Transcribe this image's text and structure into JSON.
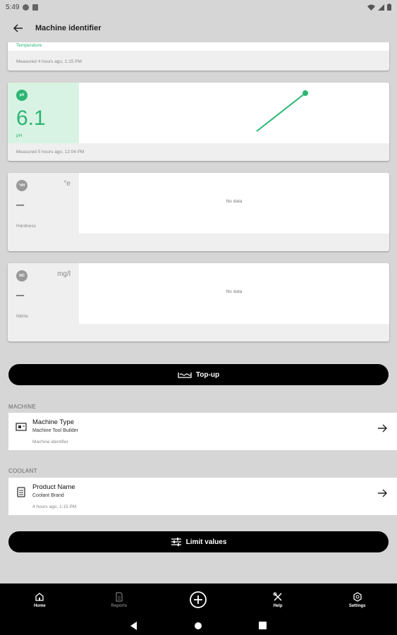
{
  "status_bar": {
    "time": "5:49"
  },
  "app_bar": {
    "title": "Machine identifier"
  },
  "cards": [
    {
      "label": "Temperature",
      "measured": "Measured 4 hours ago, 1:15 PM"
    },
    {
      "badge": "pH",
      "value": "6.1",
      "label": "pH",
      "measured": "Measured 5 hours ago, 12:04 PM",
      "accent": "#2bb673",
      "accent_bg": "#d8f3e3"
    },
    {
      "badge": "°dH",
      "unit": "°e",
      "value": "–",
      "label": "Hardness",
      "chart_text": "No data"
    },
    {
      "badge": "NO",
      "unit": "mg/l",
      "value": "–",
      "label": "Nitrite",
      "chart_text": "No data"
    }
  ],
  "topup_button": {
    "label": "Top-up",
    "icon": "topup-icon"
  },
  "machine": {
    "section": "MACHINE",
    "title": "Machine Type",
    "subtitle": "Machine Tool Builder",
    "meta": "Machine identifier",
    "icon": "machine-icon"
  },
  "coolant": {
    "section": "COOLANT",
    "title": "Product Name",
    "subtitle": "Coolant Brand",
    "meta": "4 hours ago, 1:15 PM",
    "icon": "coolant-icon"
  },
  "limit_button": {
    "label": "Limit values",
    "icon": "sliders-icon"
  },
  "bottom_nav": [
    {
      "label": "Home",
      "icon": "home-icon"
    },
    {
      "label": "Reports",
      "icon": "report-icon"
    },
    {
      "label": "",
      "icon": "add-circle-icon"
    },
    {
      "label": "Help",
      "icon": "tools-icon"
    },
    {
      "label": "Settings",
      "icon": "settings-icon"
    }
  ]
}
